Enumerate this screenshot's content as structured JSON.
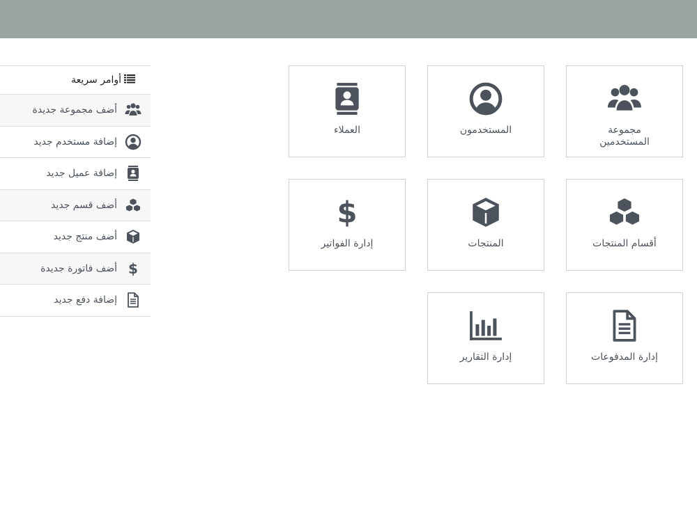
{
  "colors": {
    "topbar": "#9aa59f",
    "icon": "#4c535c",
    "border": "#cfd3d6"
  },
  "quick_commands": {
    "title": "أوامر سريعة",
    "title_icon": "list-icon",
    "items": [
      {
        "label": "أضف مجموعة جديدة",
        "icon": "users-group-icon"
      },
      {
        "label": "إضافة مستخدم جديد",
        "icon": "user-circle-icon"
      },
      {
        "label": "إضافة عميل جديد",
        "icon": "contact-book-icon"
      },
      {
        "label": "أضف قسم جديد",
        "icon": "cubes-icon"
      },
      {
        "label": "أضف منتج جديد",
        "icon": "cube-icon"
      },
      {
        "label": "أضف فاتورة جديدة",
        "icon": "dollar-icon"
      },
      {
        "label": "إضافة دفع جديد",
        "icon": "document-icon"
      }
    ]
  },
  "tiles": [
    {
      "label": "مجموعة المستخدمين",
      "icon": "users-group-icon"
    },
    {
      "label": "المستخدمون",
      "icon": "user-circle-icon"
    },
    {
      "label": "العملاء",
      "icon": "contact-book-icon"
    },
    {
      "label": "أقسام المنتجات",
      "icon": "cubes-icon"
    },
    {
      "label": "المنتجات",
      "icon": "cube-icon"
    },
    {
      "label": "إدارة الفواتير",
      "icon": "dollar-icon"
    },
    {
      "label": "إدارة المدفوعات",
      "icon": "document-icon"
    },
    {
      "label": "إدارة التقارير",
      "icon": "bar-chart-icon"
    }
  ]
}
